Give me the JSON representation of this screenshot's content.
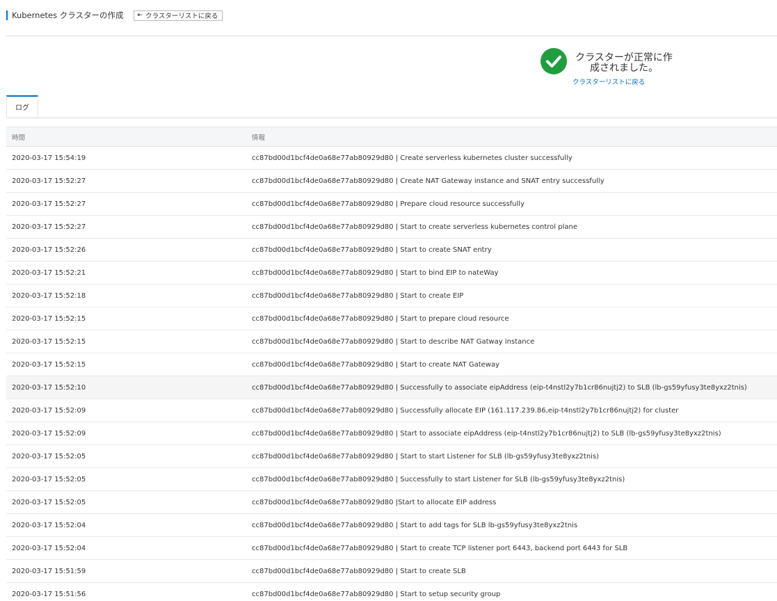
{
  "header": {
    "title": "Kubernetes クラスターの作成",
    "back_button_label": "クラスターリストに戻る"
  },
  "success": {
    "message": "クラスターが正常に作成されました。",
    "link_label": "クラスターリストに戻る",
    "color": "#1f9e3d"
  },
  "tabs": [
    {
      "label": "ログ",
      "active": true
    }
  ],
  "table": {
    "columns": [
      "時間",
      "情報"
    ],
    "rows": [
      {
        "time": "2020-03-17 15:54:19",
        "info": "cc87bd00d1bcf4de0a68e77ab80929d80 | Create serverless kubernetes cluster successfully"
      },
      {
        "time": "2020-03-17 15:52:27",
        "info": "cc87bd00d1bcf4de0a68e77ab80929d80 | Create NAT Gateway instance and SNAT entry successfully"
      },
      {
        "time": "2020-03-17 15:52:27",
        "info": "cc87bd00d1bcf4de0a68e77ab80929d80 | Prepare cloud resource successfully"
      },
      {
        "time": "2020-03-17 15:52:27",
        "info": "cc87bd00d1bcf4de0a68e77ab80929d80 | Start to create serverless kubernetes control plane"
      },
      {
        "time": "2020-03-17 15:52:26",
        "info": "cc87bd00d1bcf4de0a68e77ab80929d80 | Start to create SNAT entry"
      },
      {
        "time": "2020-03-17 15:52:21",
        "info": "cc87bd00d1bcf4de0a68e77ab80929d80 | Start to bind EIP to nateWay"
      },
      {
        "time": "2020-03-17 15:52:18",
        "info": "cc87bd00d1bcf4de0a68e77ab80929d80 | Start to create EIP"
      },
      {
        "time": "2020-03-17 15:52:15",
        "info": "cc87bd00d1bcf4de0a68e77ab80929d80 | Start to prepare cloud resource"
      },
      {
        "time": "2020-03-17 15:52:15",
        "info": "cc87bd00d1bcf4de0a68e77ab80929d80 | Start to describe NAT Gatway instance"
      },
      {
        "time": "2020-03-17 15:52:15",
        "info": "cc87bd00d1bcf4de0a68e77ab80929d80 | Start to create NAT Gateway"
      },
      {
        "time": "2020-03-17 15:52:10",
        "info": "cc87bd00d1bcf4de0a68e77ab80929d80 | Successfully to associate eipAddress (eip-t4nstl2y7b1cr86nujtj2) to SLB (lb-gs59yfusy3te8yxz2tnis)"
      },
      {
        "time": "2020-03-17 15:52:09",
        "info": "cc87bd00d1bcf4de0a68e77ab80929d80 | Successfully allocate EIP (161.117.239.86,eip-t4nstl2y7b1cr86nujtj2) for cluster"
      },
      {
        "time": "2020-03-17 15:52:09",
        "info": "cc87bd00d1bcf4de0a68e77ab80929d80 | Start to associate eipAddress (eip-t4nstl2y7b1cr86nujtj2) to SLB (lb-gs59yfusy3te8yxz2tnis)"
      },
      {
        "time": "2020-03-17 15:52:05",
        "info": "cc87bd00d1bcf4de0a68e77ab80929d80 | Start to start Listener for SLB (lb-gs59yfusy3te8yxz2tnis)"
      },
      {
        "time": "2020-03-17 15:52:05",
        "info": "cc87bd00d1bcf4de0a68e77ab80929d80 | Successfully to start Listener for SLB (lb-gs59yfusy3te8yxz2tnis)"
      },
      {
        "time": "2020-03-17 15:52:05",
        "info": "cc87bd00d1bcf4de0a68e77ab80929d80 |Start to allocate EIP address"
      },
      {
        "time": "2020-03-17 15:52:04",
        "info": "cc87bd00d1bcf4de0a68e77ab80929d80 | Start to add tags for SLB lb-gs59yfusy3te8yxz2tnis"
      },
      {
        "time": "2020-03-17 15:52:04",
        "info": "cc87bd00d1bcf4de0a68e77ab80929d80 | Start to create TCP listener port 6443, backend port 6443 for SLB"
      },
      {
        "time": "2020-03-17 15:51:59",
        "info": "cc87bd00d1bcf4de0a68e77ab80929d80 | Start to create SLB"
      },
      {
        "time": "2020-03-17 15:51:56",
        "info": "cc87bd00d1bcf4de0a68e77ab80929d80 | Start to setup security group"
      }
    ]
  }
}
